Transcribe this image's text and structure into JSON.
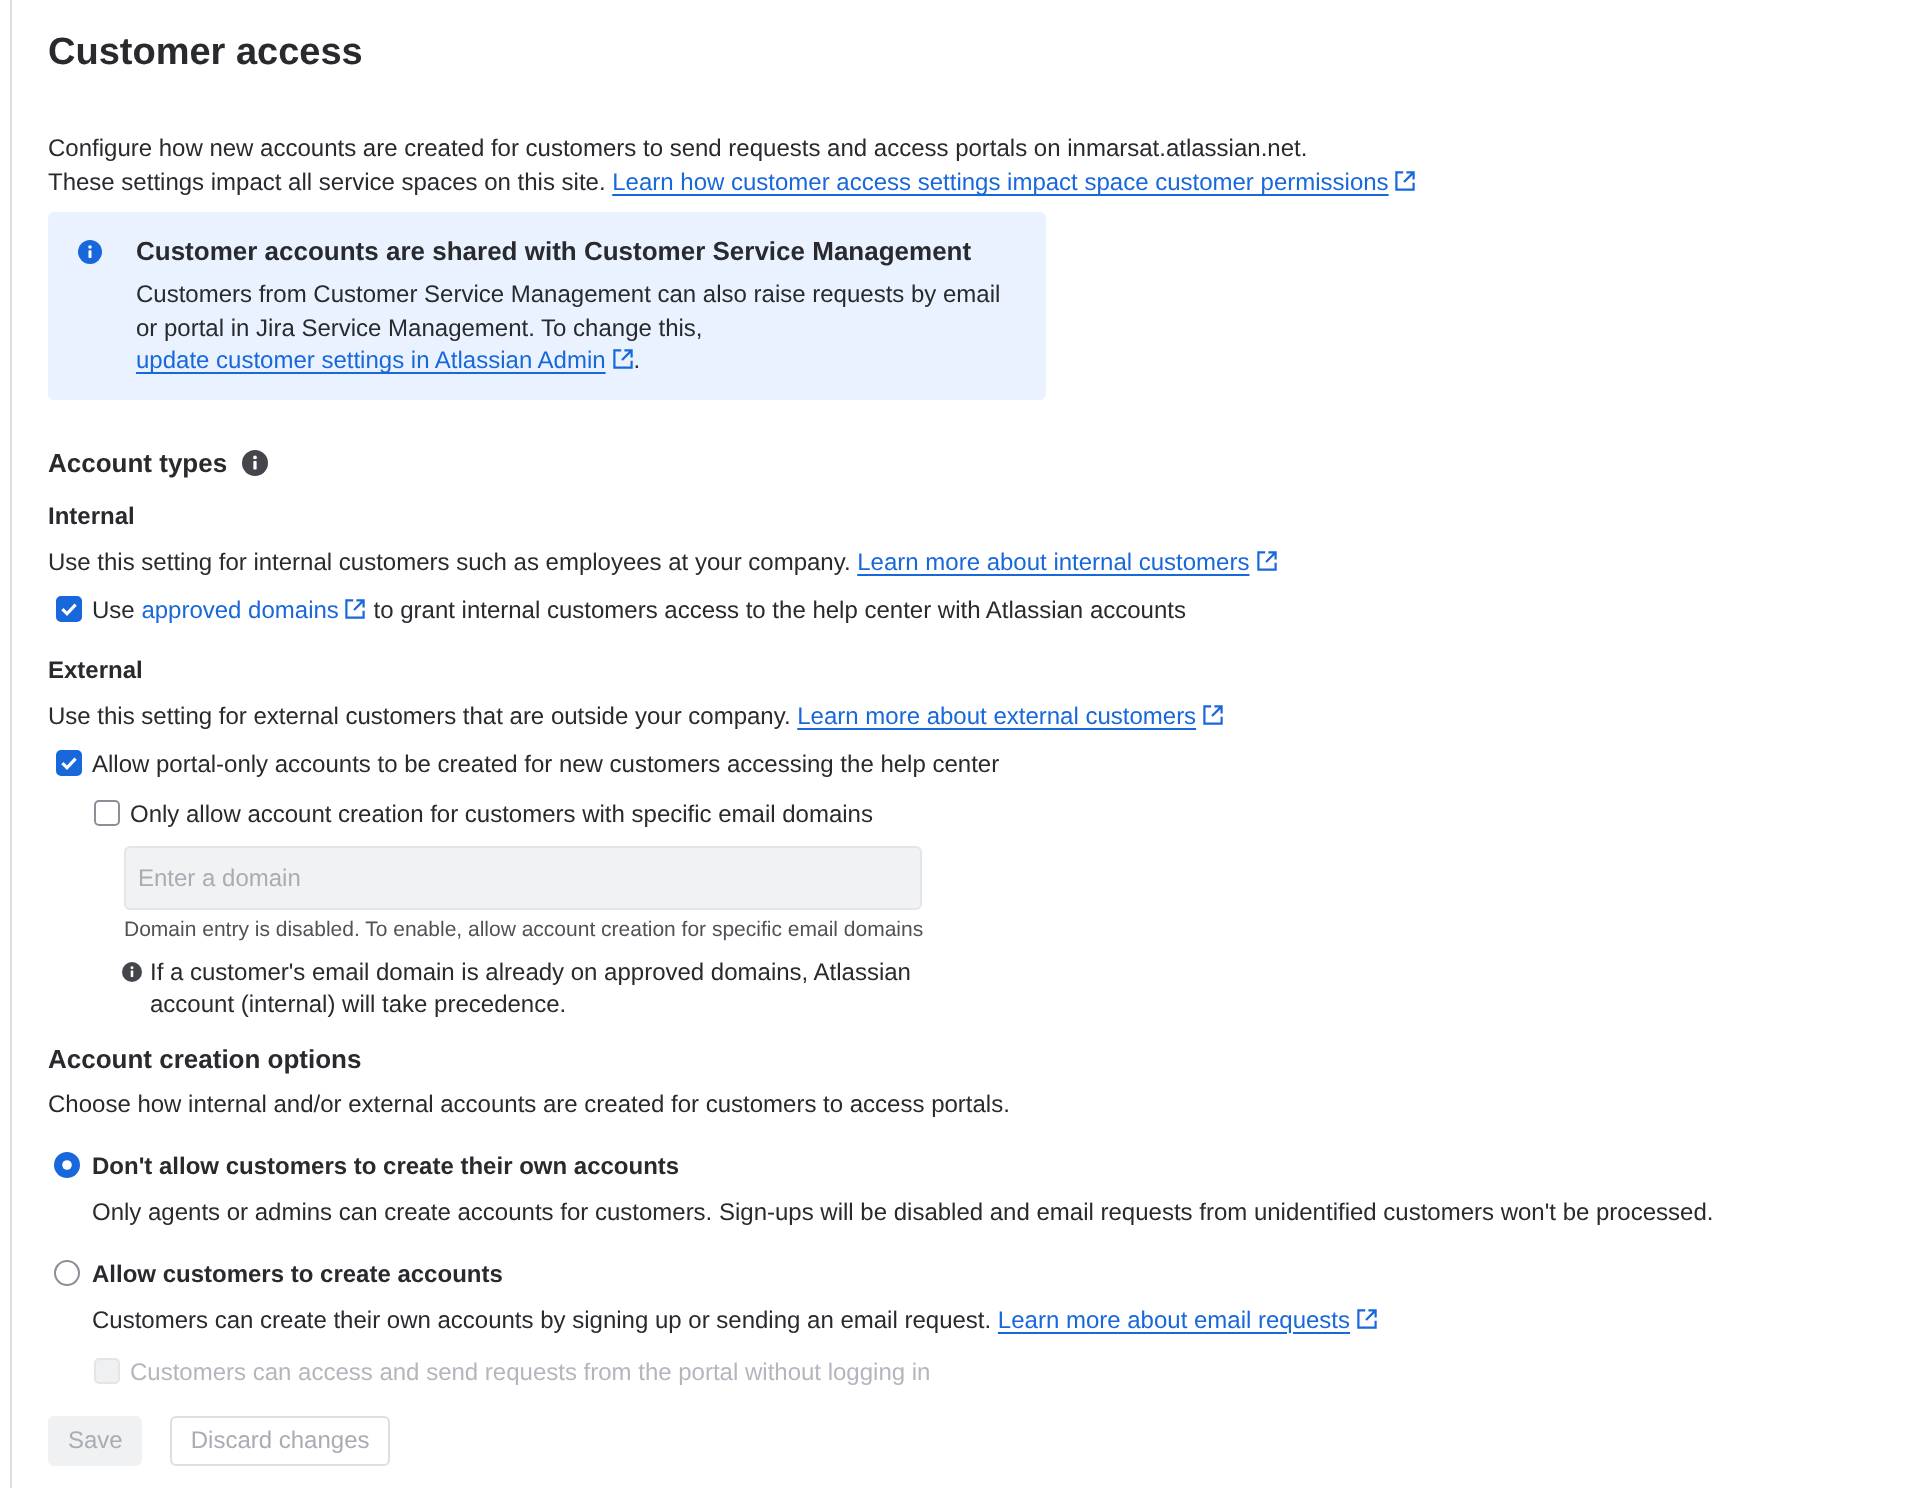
{
  "title": "Customer access",
  "intro": {
    "lines": [
      "Configure how new accounts are created for customers to send requests and access portals on inmarsat.atlassian.net.",
      "These settings impact all service spaces on this site."
    ],
    "link": "Learn how customer access settings impact space customer permissions"
  },
  "banner": {
    "title": "Customer accounts are shared with Customer Service Management",
    "text": "Customers from Customer Service Management can also raise requests by email or portal in Jira Service Management. To change this,",
    "link": "update customer settings in Atlassian Admin",
    "end": "."
  },
  "account_types": {
    "heading": "Account types",
    "sections": [
      {
        "heading": "Internal",
        "text": "Use this setting for internal customers such as employees at your company.",
        "link": "Learn more about internal customers",
        "options": [
          {
            "label_start": "Use",
            "link": "approved domains",
            "label_end": "to grant internal customers access to the help center with Atlassian accounts",
            "checked": true,
            "disabled": false
          }
        ]
      },
      {
        "heading": "External",
        "text": "Use this setting for external customers that are outside your company.",
        "link": "Learn more about external customers",
        "options": [
          {
            "label": "Allow portal-only accounts to be created for new customers accessing the help center",
            "checked": true,
            "disabled": false,
            "children": [
              {
                "label": "Only allow account creation for customers with specific email domains",
                "checked": false,
                "disabled": false,
                "field": {
                  "placeholder": "Enter a domain",
                  "disabled": true,
                  "help": "Domain entry is disabled. To enable, allow account creation for specific email domains"
                },
                "note": "If a customer's email domain is already on approved domains, Atlassian account (internal) will take precedence."
              }
            ]
          }
        ]
      }
    ]
  },
  "creation_options": {
    "heading": "Account creation options",
    "text": "Choose how internal and/or external accounts are created for customers to access portals.",
    "options": [
      {
        "label": "Don't allow customers to create their own accounts",
        "selected": true,
        "description": "Only agents or admins can create accounts for customers. Sign-ups will be disabled and email requests from unidentified customers won't be processed."
      },
      {
        "label": "Allow customers to create accounts",
        "selected": false,
        "description": "Customers can create their own accounts by signing up or sending an email request.",
        "link": "Learn more about email requests",
        "children": [
          {
            "label": "Customers can access and send requests from the portal without logging in",
            "checked": false,
            "disabled": true
          }
        ]
      }
    ]
  },
  "buttons": [
    {
      "label": "Save",
      "kind": "primary",
      "disabled": true
    },
    {
      "label": "Discard changes",
      "kind": "secondary",
      "disabled": true
    }
  ]
}
